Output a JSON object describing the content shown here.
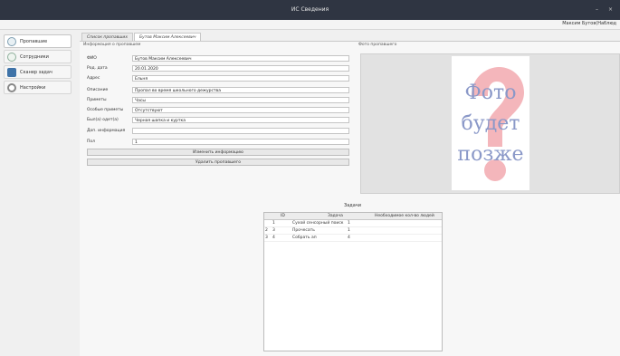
{
  "window": {
    "title": "ИС Сведения",
    "minimize": "–",
    "close": "×"
  },
  "userbar": {
    "user": "Максим Бутов(Наблюд"
  },
  "sidebar": {
    "items": [
      {
        "label": "Пропавшие",
        "icon": "person-icon",
        "color": "#7f9fb2"
      },
      {
        "label": "Сотрудники",
        "icon": "staff-icon",
        "color": "#8cae9a"
      },
      {
        "label": "Сканер задач",
        "icon": "scanner-icon",
        "color": "#3f73a8"
      },
      {
        "label": "Настройки",
        "icon": "settings-icon",
        "color": "#888888"
      }
    ]
  },
  "tabs": [
    {
      "label": "Список пропавших"
    },
    {
      "label": "Бутов Максим Алексеевич"
    }
  ],
  "info": {
    "section_label": "Информация о пропавшем",
    "fields": [
      {
        "label": "ФИО",
        "value": "Бутов Максим Алексеевич"
      },
      {
        "label": "Род. дата",
        "value": "20.01.2020"
      },
      {
        "label": "Адрес",
        "value": "Ельня"
      },
      {
        "label": "Описание",
        "value": "Пропал во время школьного дежурства"
      },
      {
        "label": "Приметы",
        "value": "Часы"
      },
      {
        "label": "Особые приметы",
        "value": "Отсутствуют"
      },
      {
        "label": "Был(а) одет(а)",
        "value": "Черная шапка и куртка"
      },
      {
        "label": "Доп. информация",
        "value": ""
      },
      {
        "label": "Пол",
        "value": "1"
      }
    ],
    "change_button": "Изменить информацию",
    "delete_button": "Удалить пропавшего"
  },
  "photo": {
    "section_label": "Фото пропавшего",
    "lines": [
      "Фото",
      "будет",
      "позже"
    ]
  },
  "tasks": {
    "title": "Задачи",
    "columns": [
      "ID",
      "Задача",
      "Необходимое кол-во людей"
    ],
    "rows": [
      {
        "marker": "",
        "id": "1",
        "task": "Сухой сенсорный поиск",
        "people": "1"
      },
      {
        "marker": "2",
        "id": "3",
        "task": "Прочесать",
        "people": "1"
      },
      {
        "marker": "3",
        "id": "4",
        "task": "Собрать ап",
        "people": "4"
      }
    ]
  },
  "colors": {
    "titlebar": "#2f3542",
    "photo_text": "#8a98c8",
    "question_mark": "#f4b6bb"
  }
}
